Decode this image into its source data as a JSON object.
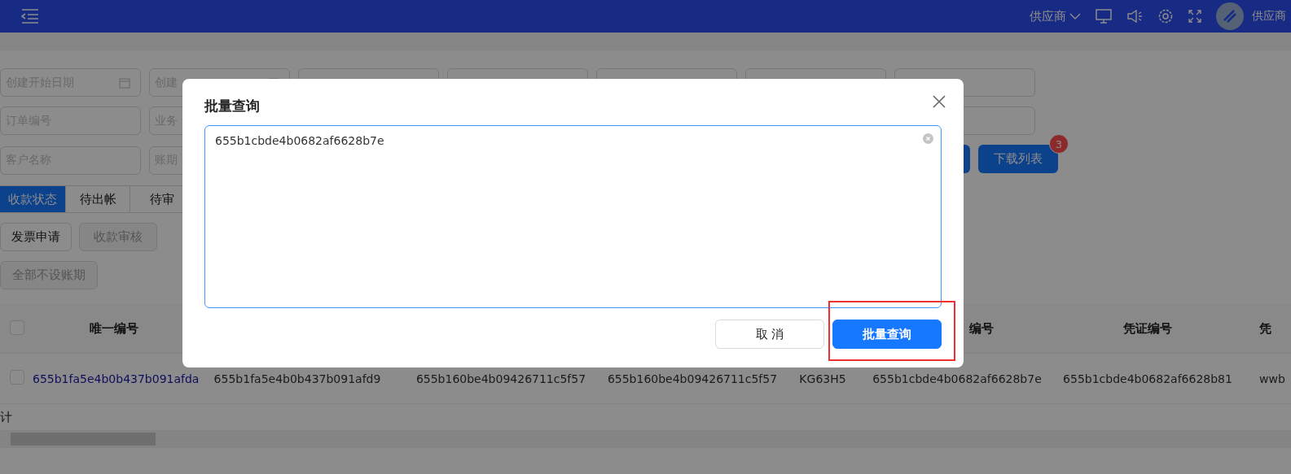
{
  "top_bar": {
    "role_menu": "供应商",
    "user_name": "供应商"
  },
  "filters": [
    [
      {
        "placeholder": "创建开始日期",
        "kind": "date"
      },
      {
        "placeholder": "创建",
        "kind": "date"
      }
    ],
    [
      {
        "placeholder": "订单编号",
        "kind": "text"
      },
      {
        "placeholder": "业务",
        "kind": "text"
      }
    ],
    [
      {
        "placeholder": "客户名称",
        "kind": "text"
      },
      {
        "placeholder": "账期",
        "kind": "text"
      }
    ]
  ],
  "list_actions": [
    {
      "kind": "primary"
    },
    {
      "kind": "primary",
      "label": "下载列表",
      "badge": "3"
    }
  ],
  "status_tabs": [
    {
      "label": "收款状态",
      "selected": true
    },
    {
      "label": "待出帐",
      "selected": false
    },
    {
      "label": "待审",
      "selected": false
    }
  ],
  "action_buttons": [
    {
      "label": "发票申请",
      "disabled": false
    },
    {
      "label": "收款审核",
      "disabled": true
    }
  ],
  "period_button": {
    "label": "全部不设账期",
    "disabled": true
  },
  "table": {
    "all_selected": false,
    "columns": [
      {
        "label": "唯一编号"
      },
      {},
      {},
      {},
      {},
      {
        "label": "编号"
      },
      {
        "label": "凭证编号"
      },
      {
        "label": "凭"
      }
    ],
    "rows": [
      {
        "selected": false,
        "cells": [
          "655b1fa5e4b0b437b091afda",
          "655b1fa5e4b0b437b091afd9",
          "655b160be4b09426711c5f57",
          "655b160be4b09426711c5f57",
          "KG63H5",
          "655b1cbde4b0682af6628b7e",
          "655b1cbde4b0682af6628b81",
          "wwb"
        ]
      }
    ],
    "total_label": "计"
  },
  "dialog": {
    "title": "批量查询",
    "value": "655b1cbde4b0682af6628b7e",
    "buttons": [
      {
        "label": "取 消",
        "kind": "default"
      },
      {
        "label": "批量查询",
        "kind": "primary"
      }
    ]
  }
}
